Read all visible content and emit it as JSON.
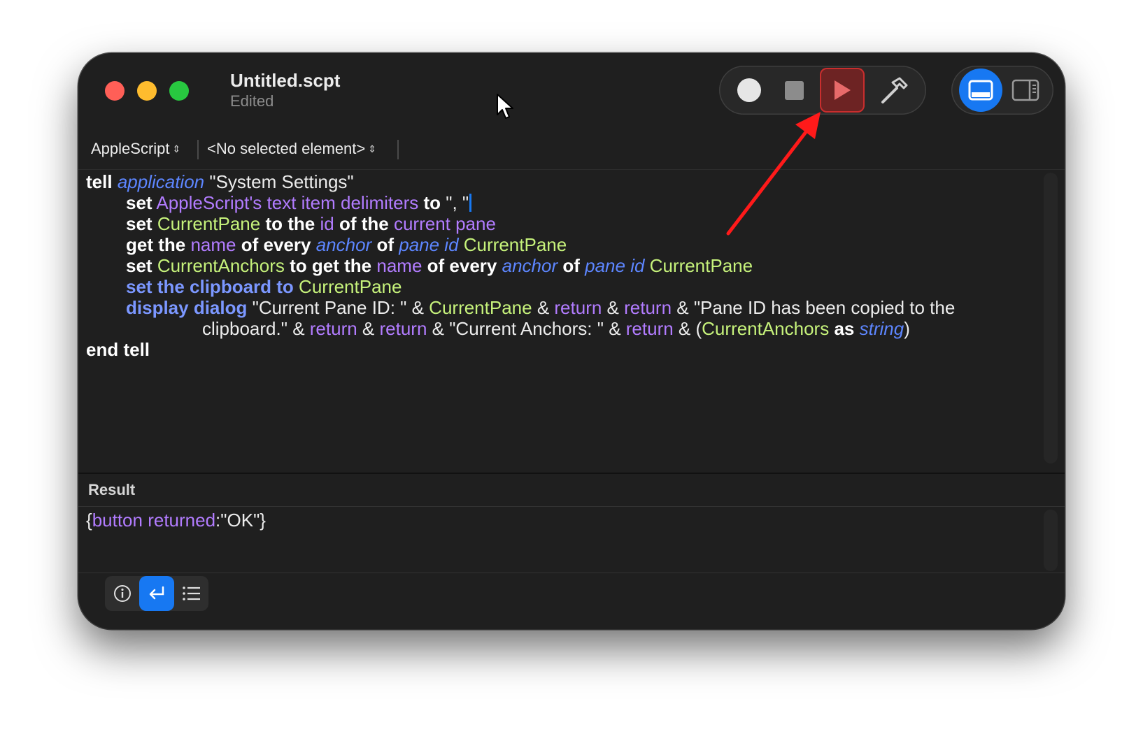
{
  "window": {
    "title": "Untitled.scpt",
    "subtitle": "Edited"
  },
  "toolbar": {
    "record": "record-button",
    "stop": "stop-button",
    "run": "run-button",
    "compile": "compile-button",
    "view_bottom": "show-bottom-pane",
    "view_side": "show-side-pane",
    "colors": {
      "run_highlight": "#c92e2e",
      "accent": "#1778f2"
    }
  },
  "navbar": {
    "language": "AppleScript",
    "element": "<No selected element>"
  },
  "editor": {
    "lines": [
      [
        {
          "t": "tell",
          "c": "kw"
        },
        {
          "t": " ",
          "c": ""
        },
        {
          "t": "application",
          "c": "cls"
        },
        {
          "t": " \"System Settings\"",
          "c": ""
        }
      ],
      [
        {
          "t": "set",
          "c": "kw"
        },
        {
          "t": " ",
          "c": ""
        },
        {
          "t": "AppleScript's text item delimiters",
          "c": "prop"
        },
        {
          "t": " ",
          "c": ""
        },
        {
          "t": "to",
          "c": "kw"
        },
        {
          "t": " \", \"",
          "c": ""
        }
      ],
      [
        {
          "t": "set",
          "c": "kw"
        },
        {
          "t": " ",
          "c": ""
        },
        {
          "t": "CurrentPane",
          "c": "var"
        },
        {
          "t": " ",
          "c": ""
        },
        {
          "t": "to the",
          "c": "kw"
        },
        {
          "t": " ",
          "c": ""
        },
        {
          "t": "id",
          "c": "prop"
        },
        {
          "t": " ",
          "c": ""
        },
        {
          "t": "of the",
          "c": "kw"
        },
        {
          "t": " ",
          "c": ""
        },
        {
          "t": "current pane",
          "c": "prop"
        }
      ],
      [
        {
          "t": "get the",
          "c": "kw"
        },
        {
          "t": " ",
          "c": ""
        },
        {
          "t": "name",
          "c": "prop"
        },
        {
          "t": " ",
          "c": ""
        },
        {
          "t": "of every",
          "c": "kw"
        },
        {
          "t": " ",
          "c": ""
        },
        {
          "t": "anchor",
          "c": "cls"
        },
        {
          "t": " ",
          "c": ""
        },
        {
          "t": "of",
          "c": "kw"
        },
        {
          "t": " ",
          "c": ""
        },
        {
          "t": "pane id",
          "c": "cls"
        },
        {
          "t": " ",
          "c": ""
        },
        {
          "t": "CurrentPane",
          "c": "var"
        }
      ],
      [
        {
          "t": "set",
          "c": "kw"
        },
        {
          "t": " ",
          "c": ""
        },
        {
          "t": "CurrentAnchors",
          "c": "var"
        },
        {
          "t": " ",
          "c": ""
        },
        {
          "t": "to get the",
          "c": "kw"
        },
        {
          "t": " ",
          "c": ""
        },
        {
          "t": "name",
          "c": "prop"
        },
        {
          "t": " ",
          "c": ""
        },
        {
          "t": "of every",
          "c": "kw"
        },
        {
          "t": " ",
          "c": ""
        },
        {
          "t": "anchor",
          "c": "cls"
        },
        {
          "t": " ",
          "c": ""
        },
        {
          "t": "of",
          "c": "kw"
        },
        {
          "t": " ",
          "c": ""
        },
        {
          "t": "pane id",
          "c": "cls"
        },
        {
          "t": " ",
          "c": ""
        },
        {
          "t": "CurrentPane",
          "c": "var"
        }
      ],
      [
        {
          "t": "set the clipboard to",
          "c": "cmd"
        },
        {
          "t": " ",
          "c": ""
        },
        {
          "t": "CurrentPane",
          "c": "var"
        }
      ],
      [
        {
          "t": "display dialog",
          "c": "cmd"
        },
        {
          "t": " \"Current Pane ID: \" & ",
          "c": ""
        },
        {
          "t": "CurrentPane",
          "c": "var"
        },
        {
          "t": " & ",
          "c": ""
        },
        {
          "t": "return",
          "c": "prop"
        },
        {
          "t": " & ",
          "c": ""
        },
        {
          "t": "return",
          "c": "prop"
        },
        {
          "t": " & \"Pane ID has been copied to the",
          "c": ""
        }
      ],
      [
        {
          "t": "clipboard.\" & ",
          "c": ""
        },
        {
          "t": "return",
          "c": "prop"
        },
        {
          "t": " & ",
          "c": ""
        },
        {
          "t": "return",
          "c": "prop"
        },
        {
          "t": " & \"Current Anchors: \" & ",
          "c": ""
        },
        {
          "t": "return",
          "c": "prop"
        },
        {
          "t": " & (",
          "c": ""
        },
        {
          "t": "CurrentAnchors",
          "c": "var"
        },
        {
          "t": " ",
          "c": ""
        },
        {
          "t": "as",
          "c": "kw"
        },
        {
          "t": " ",
          "c": ""
        },
        {
          "t": "string",
          "c": "cls"
        },
        {
          "t": ")",
          "c": ""
        }
      ],
      [
        {
          "t": "end tell",
          "c": "kw"
        }
      ]
    ]
  },
  "result": {
    "label": "Result",
    "value": [
      {
        "t": "{",
        "c": ""
      },
      {
        "t": "button returned",
        "c": "prop"
      },
      {
        "t": ":\"OK\"}",
        "c": ""
      }
    ]
  },
  "bottombar": {
    "tabs": [
      "info-tab",
      "result-tab",
      "log-tab"
    ],
    "active": "result-tab"
  }
}
